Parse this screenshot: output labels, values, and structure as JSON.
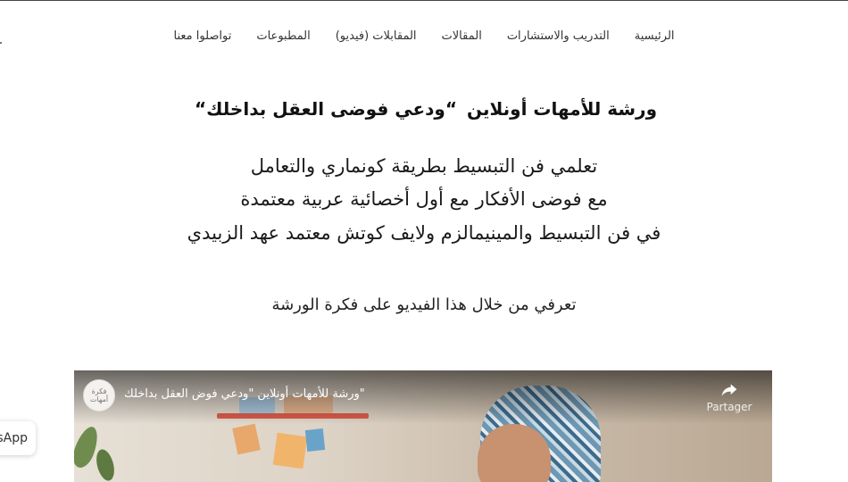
{
  "nav": {
    "items": [
      {
        "label": "الرئيسية"
      },
      {
        "label": "التدريب والاستشارات"
      },
      {
        "label": "المقالات"
      },
      {
        "label": "المقابلات (فيديو)"
      },
      {
        "label": "المطبوعات"
      },
      {
        "label": "تواصلوا معنا"
      }
    ]
  },
  "hero": {
    "title_prefix": "ورشة للأمهات أونلاين",
    "title_highlight": "“ودعي فوضى العقل بداخلك“",
    "lines": [
      "تعلمي فن التبسيط بطريقة كونماري والتعامل",
      "مع فوضى الأفكار مع أول أخصائية عربية معتمدة",
      "في فن التبسيط والمينيمالزم ولايف كوتش معتمد عهد الزبيدي"
    ],
    "cta": "تعرفي من خلال هذا الفيديو على فكرة الورشة"
  },
  "video": {
    "title": "\"ورشة للأمهات أونلاين \"ودعي فوض العقل بداخلك",
    "channel_avatar_text": "فكرة أمهات",
    "share_label": "Partager",
    "share_icon": "share-arrow-icon"
  },
  "whatsapp": {
    "label": "sApp"
  },
  "colors": {
    "highlight": "#e9b3e0",
    "text": "#1a1a1a",
    "nav_text": "#333333"
  }
}
